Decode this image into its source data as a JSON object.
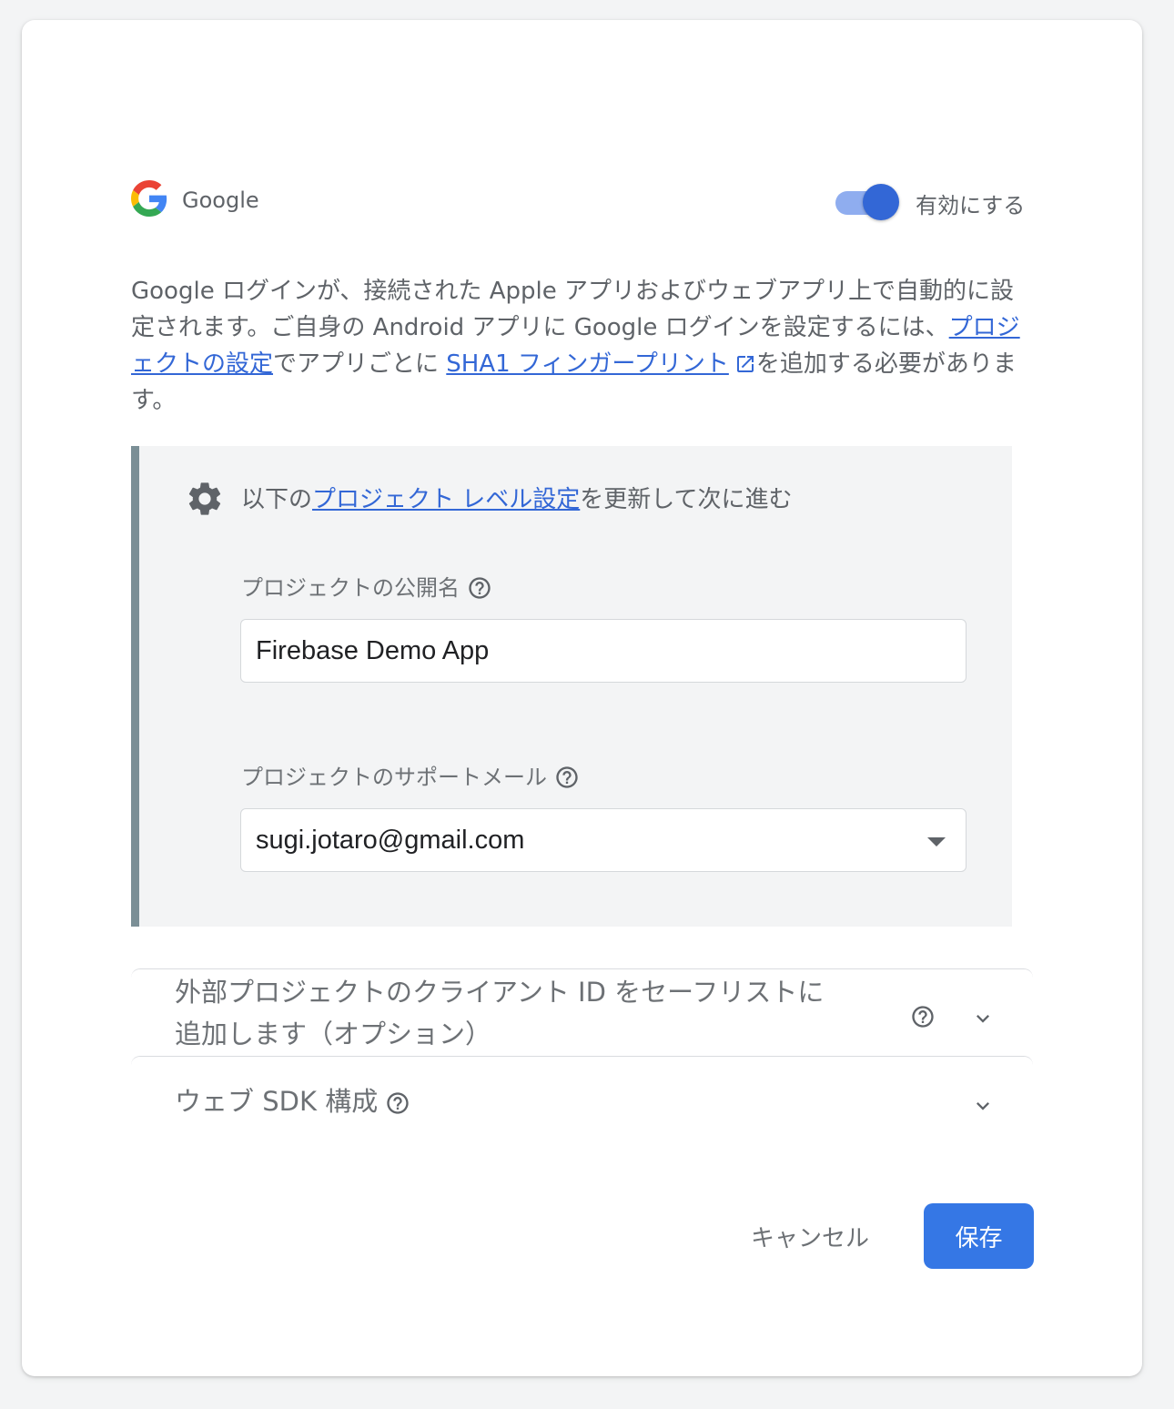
{
  "provider": {
    "name": "Google",
    "enable_label": "有効にする",
    "enabled": true
  },
  "description": {
    "part1": "Google ログインが、接続された Apple アプリおよびウェブアプリ上で自動的に設定されます。ご自身の Android アプリに Google ログインを設定するには、",
    "link_project_settings": "プロジェクトの設定",
    "part2": "でアプリごとに ",
    "link_sha1": "SHA1 フィンガープリント",
    "part3": "を追加する必要があります。"
  },
  "project_panel": {
    "title_prefix": "以下の",
    "title_link": "プロジェクト レベル設定",
    "title_suffix": "を更新して次に進む",
    "public_name_label": "プロジェクトの公開名",
    "public_name_value": "Firebase Demo App",
    "support_email_label": "プロジェクトのサポートメール",
    "support_email_value": "sugi.jotaro@gmail.com"
  },
  "expanders": {
    "safelist_line1": "外部プロジェクトのクライアント ID をセーフリストに",
    "safelist_line2": "追加します（オプション）",
    "web_sdk": "ウェブ SDK 構成"
  },
  "actions": {
    "cancel": "キャンセル",
    "save": "保存"
  },
  "colors": {
    "accent": "#3367d6",
    "save_button": "#3577e5",
    "panel_bar": "#7b8f96"
  }
}
